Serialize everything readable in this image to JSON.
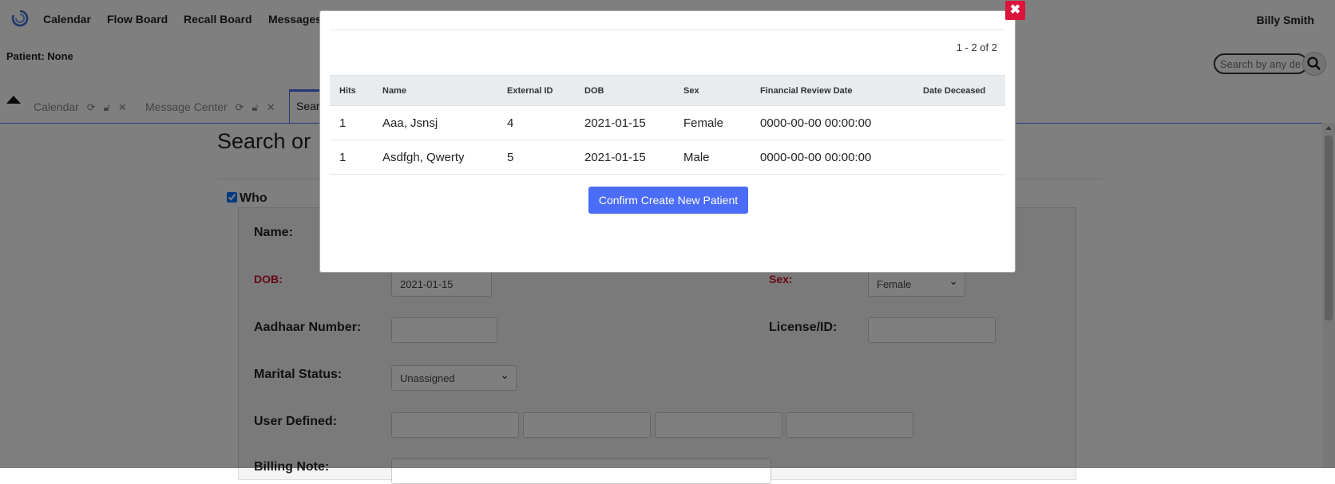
{
  "nav": {
    "items": [
      "Calendar",
      "Flow Board",
      "Recall Board",
      "Messages"
    ],
    "user": "Billy Smith"
  },
  "patient_label": "Patient: None",
  "search": {
    "placeholder": "Search by any de"
  },
  "tabs": [
    {
      "label": "Calendar"
    },
    {
      "label": "Message Center"
    }
  ],
  "active_tab": "Sear",
  "page": {
    "title": "Search or",
    "who_label": "Who",
    "fields": {
      "name_label": "Name:",
      "dob_label": "DOB:",
      "dob_value": "2021-01-15",
      "sex_label": "Sex:",
      "sex_value": "Female",
      "aadhaar_label": "Aadhaar Number:",
      "license_label": "License/ID:",
      "marital_label": "Marital Status:",
      "marital_value": "Unassigned",
      "user_defined_label": "User Defined:",
      "billing_note_label": "Billing Note:"
    }
  },
  "modal": {
    "pager": "1 - 2 of 2",
    "columns": [
      "Hits",
      "Name",
      "External ID",
      "DOB",
      "Sex",
      "Financial Review Date",
      "Date Deceased"
    ],
    "rows": [
      [
        "1",
        "Aaa, Jsnsj",
        "4",
        "2021-01-15",
        "Female",
        "0000-00-00 00:00:00",
        ""
      ],
      [
        "1",
        "Asdfgh, Qwerty",
        "5",
        "2021-01-15",
        "Male",
        "0000-00-00 00:00:00",
        ""
      ]
    ],
    "confirm_label": "Confirm Create New Patient",
    "close_glyph": "✖"
  },
  "colors": {
    "accent": "#4a6cf7",
    "close": "#dc143c",
    "required": "#c8102e"
  }
}
